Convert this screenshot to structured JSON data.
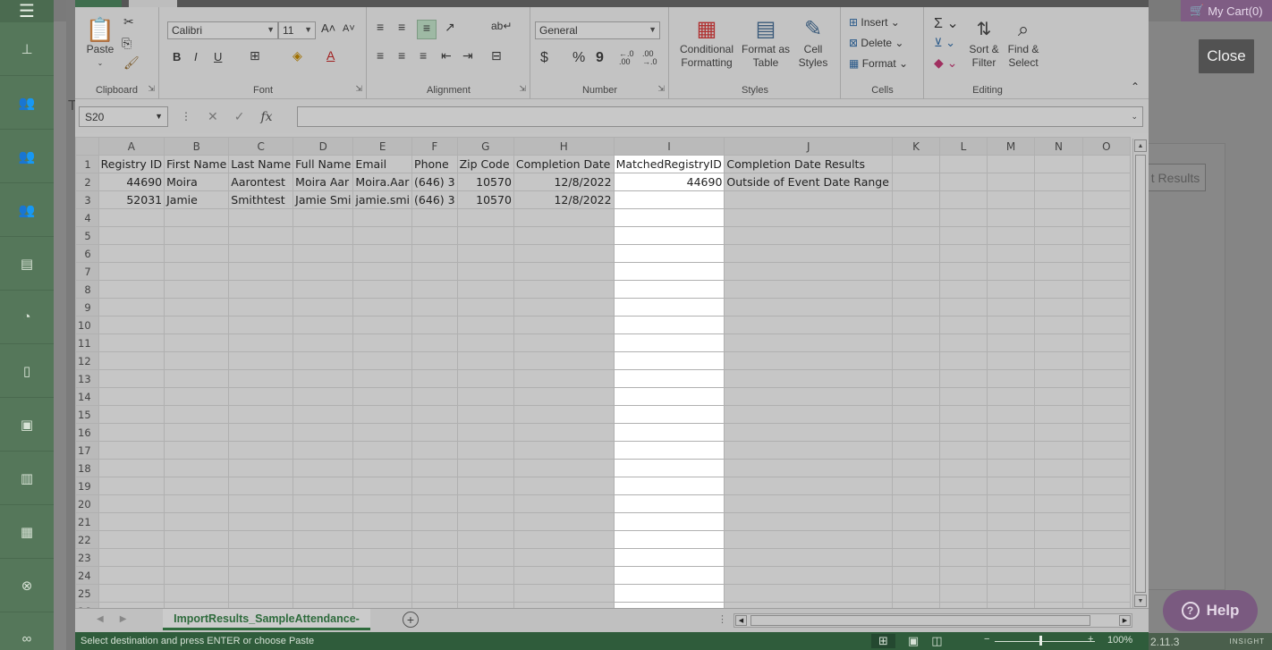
{
  "app": {
    "close_label": "Close",
    "cart_label": "My Cart(0)",
    "results_label": "t Results",
    "help_label": "Help",
    "version": "2.11.3",
    "brand": "INSIGHT",
    "partial_letter": "T"
  },
  "excel": {
    "ribbon": {
      "clipboard": {
        "label": "Clipboard",
        "paste": "Paste"
      },
      "font": {
        "label": "Font",
        "name": "Calibri",
        "size": "11",
        "bold": "B",
        "italic": "I",
        "underline": "U"
      },
      "alignment": {
        "label": "Alignment"
      },
      "number": {
        "label": "Number",
        "format": "General",
        "currency": "$",
        "percent": "%",
        "comma": "9",
        "inc_decimal": "←.0\n.00",
        "dec_decimal": ".00\n→.0"
      },
      "styles": {
        "label": "Styles",
        "conditional": "Conditional",
        "conditional2": "Formatting",
        "format_table": "Format as",
        "format_table2": "Table",
        "cell_styles": "Cell",
        "cell_styles2": "Styles"
      },
      "cells": {
        "label": "Cells",
        "insert": "Insert",
        "delete": "Delete",
        "format": "Format"
      },
      "editing": {
        "label": "Editing",
        "sort": "Sort &",
        "sort2": "Filter",
        "find": "Find &",
        "find2": "Select"
      }
    },
    "formula_bar": {
      "name_box": "S20",
      "fx": "fx",
      "formula": ""
    },
    "columns": [
      "A",
      "B",
      "C",
      "D",
      "E",
      "F",
      "G",
      "H",
      "I",
      "J",
      "K",
      "L",
      "M",
      "N",
      "O"
    ],
    "rows": [
      [
        "Registry ID",
        "First Name",
        "Last Name",
        "Full Name",
        "Email",
        "Phone",
        "Zip Code",
        "Completion Date",
        "MatchedRegistryID",
        "Completion Date Results",
        "",
        "",
        "",
        "",
        ""
      ],
      [
        "44690",
        "Moira",
        "Aarontest",
        "Moira Aar",
        "Moira.Aar",
        "(646) 3",
        "10570",
        "12/8/2022",
        "44690",
        "Outside of Event Date Range",
        "",
        "",
        "",
        "",
        ""
      ],
      [
        "52031",
        "Jamie",
        "Smithtest",
        "Jamie Smi",
        "jamie.smi",
        "(646) 3",
        "10570",
        "12/8/2022",
        "",
        "",
        "",
        "",
        "",
        "",
        ""
      ]
    ],
    "row_count": 26,
    "sheet_tab": "ImportResults_SampleAttendance-",
    "status_text": "Select destination and press ENTER or choose Paste",
    "zoom": "100%"
  }
}
